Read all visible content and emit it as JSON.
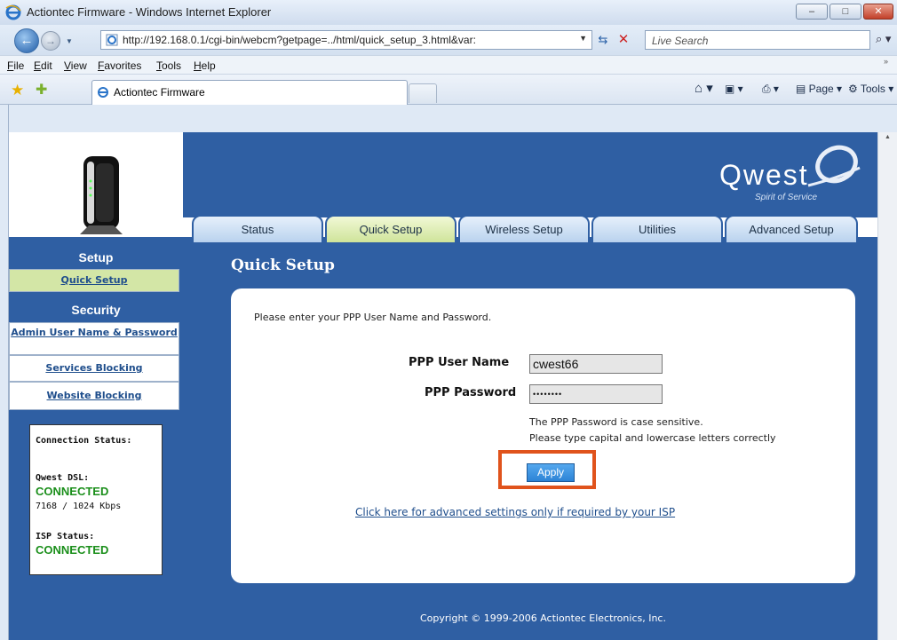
{
  "window": {
    "title": "Actiontec Firmware - Windows Internet Explorer",
    "minimize": "–",
    "maximize": "□",
    "close": "✕"
  },
  "address_bar": {
    "url": "http://192.168.0.1/cgi-bin/webcm?getpage=../html/quick_setup_3.html&var:",
    "search_placeholder": "Live Search"
  },
  "menu": [
    "File",
    "Edit",
    "View",
    "Favorites",
    "Tools",
    "Help"
  ],
  "browser_tab": {
    "label": "Actiontec Firmware"
  },
  "command_bar": {
    "page": "Page",
    "tools": "Tools"
  },
  "brand": {
    "name": "Qwest",
    "tagline": "Spirit of Service"
  },
  "nav_tabs": [
    {
      "label": "Status",
      "active": false
    },
    {
      "label": "Quick Setup",
      "active": true
    },
    {
      "label": "Wireless Setup",
      "active": false
    },
    {
      "label": "Utilities",
      "active": false
    },
    {
      "label": "Advanced Setup",
      "active": false
    }
  ],
  "sidebar": {
    "setup_heading": "Setup",
    "setup_items": [
      "Quick Setup"
    ],
    "security_heading": "Security",
    "security_items": [
      "Admin User Name & Password",
      "Services Blocking",
      "Website Blocking"
    ]
  },
  "connection_status": {
    "heading": "Connection Status:",
    "dsl_label": "Qwest DSL:",
    "dsl_value": "CONNECTED",
    "dsl_speed": "7168 / 1024 Kbps",
    "isp_label": "ISP Status:",
    "isp_value": "CONNECTED"
  },
  "main": {
    "title": "Quick Setup",
    "intro": "Please enter your PPP User Name and Password.",
    "username_label": "PPP User Name",
    "username_value": "cwest66",
    "password_label": "PPP Password",
    "password_value": "••••••••",
    "note_line1": "The PPP Password is case sensitive.",
    "note_line2": "Please type capital and lowercase letters correctly",
    "apply_label": "Apply",
    "advanced_link": "Click here for advanced settings only if required by your ISP"
  },
  "footer": {
    "copyright": "Copyright © 1999-2006 Actiontec Electronics, Inc."
  },
  "colors": {
    "page_blue": "#2f5fa3",
    "active_tab": "#cfe49a",
    "highlight": "#e0531c",
    "connected": "#1b8f1b"
  }
}
